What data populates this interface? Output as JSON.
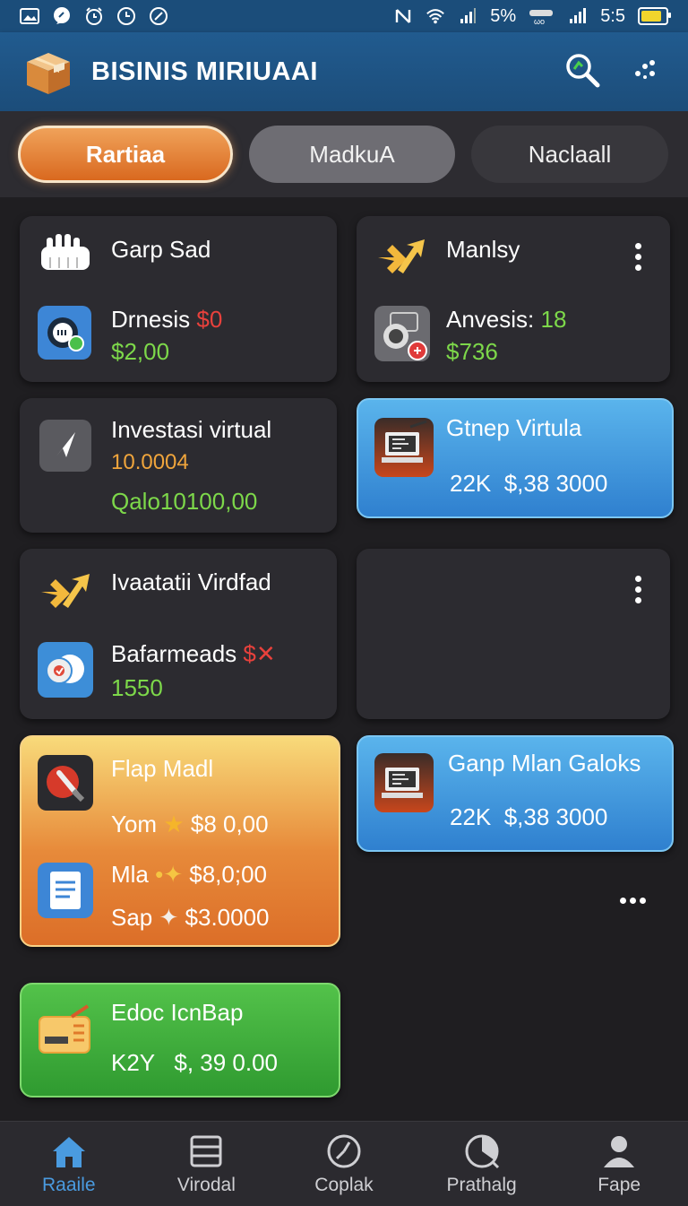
{
  "status_bar": {
    "battery_percent": "5%",
    "time": "5:5",
    "left_icons": [
      "image-icon",
      "chat-icon",
      "alarm-icon",
      "clock-icon",
      "compass-icon"
    ],
    "right_icons": [
      "nfc-icon",
      "wifi-icon",
      "signal-icon",
      "hotspot-icon",
      "signal-icon",
      "battery-icon"
    ]
  },
  "app_bar": {
    "title": "BISINIS MIRIUAAI"
  },
  "tabs": [
    {
      "label": "Rartiaa",
      "active": true
    },
    {
      "label": "MadkuA",
      "active": false
    },
    {
      "label": "Naclaall",
      "active": false
    }
  ],
  "cards": {
    "c1": {
      "title": "Garp Sad",
      "line1_label": "Drnesis",
      "line1_value": "$0",
      "line2": "$2,00"
    },
    "c2": {
      "title": "Manlsy",
      "line1_label": "Anvesis:",
      "line1_value": "18",
      "line2": "$736"
    },
    "c3": {
      "title": "Investasi virtual",
      "line1": "10.0004",
      "line2": "Qalo10100,00"
    },
    "c4": {
      "title": "Gtnep Virtula",
      "line1_a": "22K",
      "line1_b": "$,38 3000"
    },
    "c5": {
      "title": "Ivaatatii Virdfad",
      "line1_label": "Bafarmeads",
      "line1_value": "$✕",
      "line2": "1550"
    },
    "c6": {
      "title": "Flap Madl",
      "rows": [
        {
          "label": "Yom",
          "value": "$8 0,00"
        },
        {
          "label": "Mla",
          "value": "$8,0;00"
        },
        {
          "label": "Sap",
          "value": "$3.0000"
        }
      ]
    },
    "c7": {
      "title": "Ganp Mlan Galoks",
      "line1_a": "22K",
      "line1_b": "$,38 3000"
    },
    "c8": {
      "title": "Edoc IcnBap",
      "line1_a": "K2Y",
      "line1_b": "$, 39 0.00"
    }
  },
  "bottom_nav": [
    {
      "label": "Raaile",
      "icon": "home-icon",
      "active": true
    },
    {
      "label": "Virodal",
      "icon": "list-icon",
      "active": false
    },
    {
      "label": "Coplak",
      "icon": "clock-icon",
      "active": false
    },
    {
      "label": "Prathalg",
      "icon": "timer-icon",
      "active": false
    },
    {
      "label": "Fape",
      "icon": "person-icon",
      "active": false
    }
  ],
  "colors": {
    "app_bar": "#1c4d7a",
    "background": "#1f1e21",
    "card": "#2c2b30",
    "accent_orange": "#d9691f",
    "accent_blue": "#3a8fd8",
    "accent_green": "#3fa83a",
    "positive": "#7dd84a",
    "negative": "#e8413c"
  }
}
